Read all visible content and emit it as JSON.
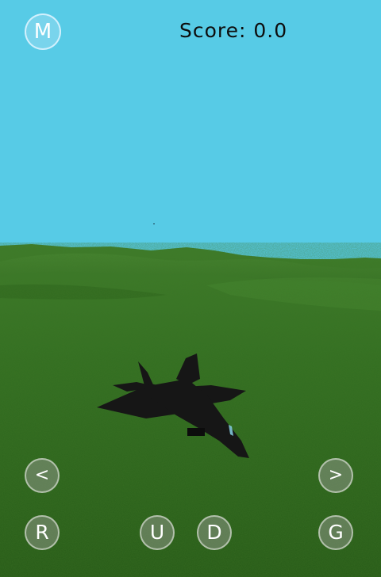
{
  "hud": {
    "menu_label": "M",
    "score_label": "Score:",
    "score_value": "0.0",
    "left_label": "<",
    "right_label": ">",
    "reset_label": "R",
    "up_label": "U",
    "down_label": "D",
    "gun_label": "G"
  },
  "colors": {
    "sky": "#57cbe6",
    "grass": "#2f6a1d",
    "aircraft": "#161616"
  },
  "icons": {
    "aircraft": "fighter-jet-silhouette"
  }
}
